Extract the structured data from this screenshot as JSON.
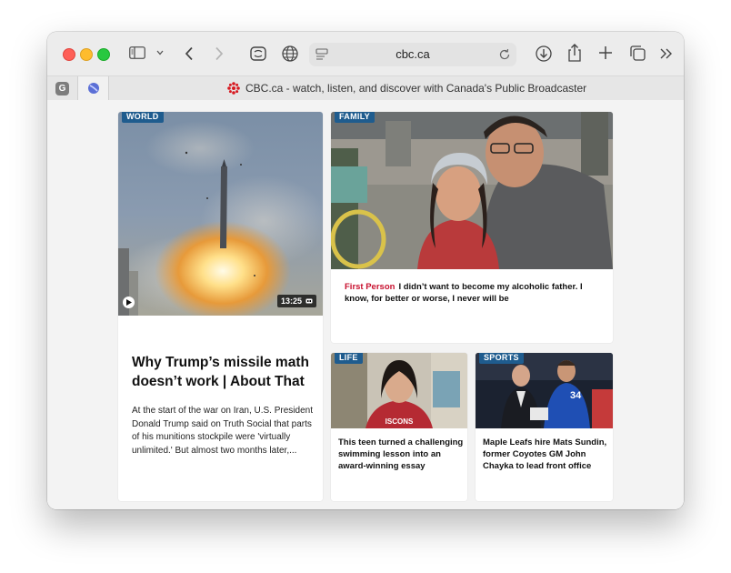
{
  "browser": {
    "url": "cbc.ca",
    "tab_title": "CBC.ca - watch, listen, and discover with Canada's Public Broadcaster",
    "pinned_tabs": [
      {
        "letter": "G",
        "icon": "g-icon"
      },
      {
        "icon": "globe-blue-icon"
      }
    ],
    "toolbar_icons": [
      "sidebar-icon",
      "chevron-down-icon",
      "back-icon",
      "forward-icon",
      "extension-icon",
      "globe-icon",
      "reader-icon",
      "reload-icon",
      "download-icon",
      "share-icon",
      "new-tab-icon",
      "tabs-overview-icon",
      "more-icon"
    ]
  },
  "stories": {
    "main": {
      "tag": "WORLD",
      "headline": "Why Trump’s missile math doesn’t work | About That",
      "description": "At the start of the war on Iran, U.S. President Donald Trump said on Truth Social that parts of his munitions stockpile were 'virtually unlimited.' But almost two months later,...",
      "duration": "13:25"
    },
    "family": {
      "tag": "FAMILY",
      "label": "First Person",
      "headline": "I didn’t want to become my alcoholic father. I know, for better or worse, I never will be"
    },
    "life": {
      "tag": "LIFE",
      "headline": "This teen turned a challenging swimming lesson into an award-winning essay"
    },
    "sports": {
      "tag": "SPORTS",
      "headline": "Maple Leafs hire Mats Sundin, former Coyotes GM John Chayka to lead front office"
    }
  },
  "colors": {
    "tag_bg": "#1f5c8e",
    "first_person": "#c8102e",
    "cbc_red": "#d71920"
  }
}
